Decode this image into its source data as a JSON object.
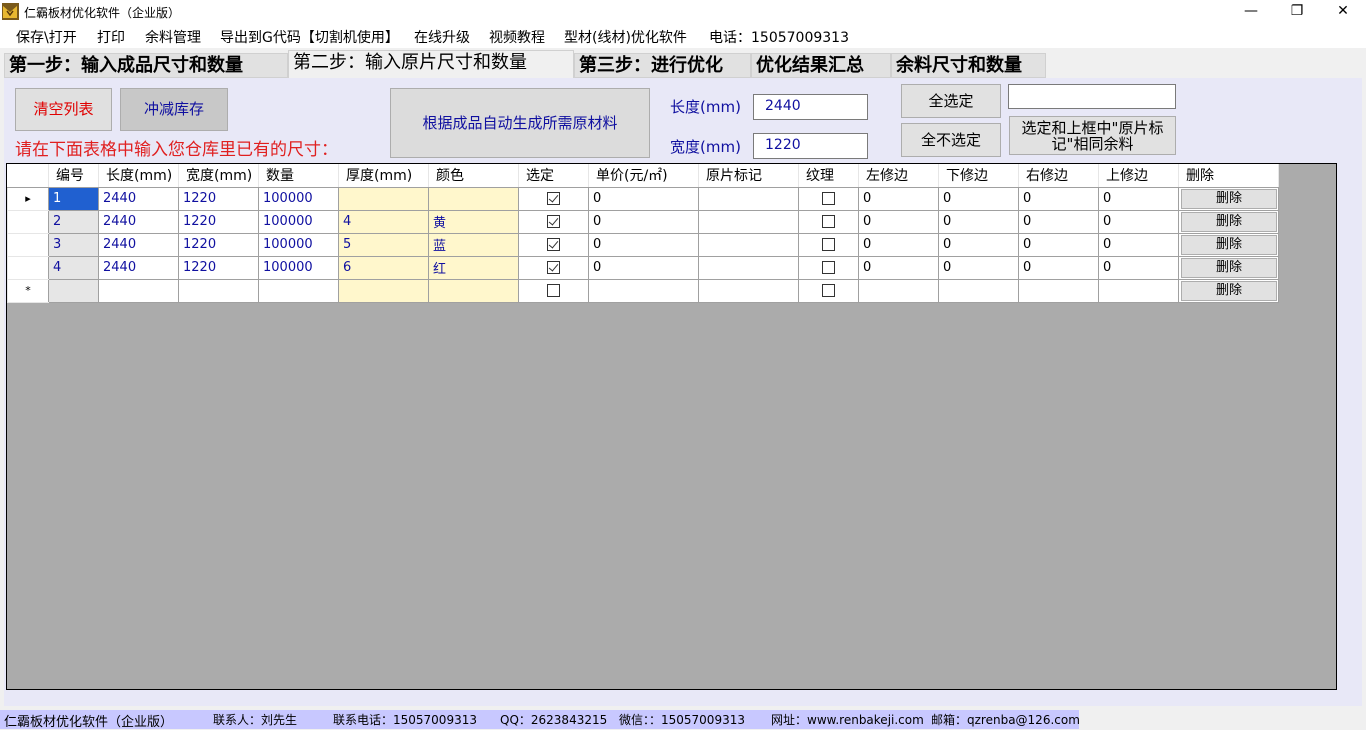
{
  "window": {
    "title": "仁霸板材优化软件（企业版）",
    "minimize": "—",
    "restore": "❐",
    "close": "✕"
  },
  "menu": [
    "保存\\打开",
    "打印",
    "余料管理",
    "导出到G代码【切割机使用】",
    "在线升级",
    "视频教程",
    "型材(线材)优化软件",
    "电话：15057009313"
  ],
  "tabs": [
    "第一步：输入成品尺寸和数量",
    "第二步：输入原片尺寸和数量",
    "第三步：进行优化",
    "优化结果汇总",
    "余料尺寸和数量"
  ],
  "active_tab": 1,
  "buttons": {
    "clear_list": "清空列表",
    "deduct_stock": "冲减库存",
    "auto_generate": "根据成品自动生成所需原材料",
    "select_all": "全选定",
    "select_none": "全不选定",
    "select_same_mark": "选定和上框中\"原片标记\"相同余料"
  },
  "hint": "请在下面表格中输入您仓库里已有的尺寸：",
  "fields": {
    "length_label": "长度(mm)",
    "length_value": "2440",
    "width_label": "宽度(mm)",
    "width_value": "1220",
    "mark_value": ""
  },
  "grid": {
    "columns": [
      "编号",
      "长度(mm)",
      "宽度(mm)",
      "数量",
      "厚度(mm)",
      "颜色",
      "选定",
      "单价(元/㎡)",
      "原片标记",
      "纹理",
      "左修边",
      "下修边",
      "右修边",
      "上修边",
      "删除"
    ],
    "rows": [
      {
        "marker": "▸",
        "id": "1",
        "length": "2440",
        "width": "1220",
        "qty": "100000",
        "thickness": "",
        "color": "",
        "selected": true,
        "price": "0",
        "mark": "",
        "grain": false,
        "left": "0",
        "bottom": "0",
        "right": "0",
        "top": "0",
        "delete": "删除"
      },
      {
        "marker": "",
        "id": "2",
        "length": "2440",
        "width": "1220",
        "qty": "100000",
        "thickness": "4",
        "color": "黄",
        "selected": true,
        "price": "0",
        "mark": "",
        "grain": false,
        "left": "0",
        "bottom": "0",
        "right": "0",
        "top": "0",
        "delete": "删除"
      },
      {
        "marker": "",
        "id": "3",
        "length": "2440",
        "width": "1220",
        "qty": "100000",
        "thickness": "5",
        "color": "蓝",
        "selected": true,
        "price": "0",
        "mark": "",
        "grain": false,
        "left": "0",
        "bottom": "0",
        "right": "0",
        "top": "0",
        "delete": "删除"
      },
      {
        "marker": "",
        "id": "4",
        "length": "2440",
        "width": "1220",
        "qty": "100000",
        "thickness": "6",
        "color": "红",
        "selected": true,
        "price": "0",
        "mark": "",
        "grain": false,
        "left": "0",
        "bottom": "0",
        "right": "0",
        "top": "0",
        "delete": "删除"
      },
      {
        "marker": "*",
        "id": "",
        "length": "",
        "width": "",
        "qty": "",
        "thickness": "",
        "color": "",
        "selected": false,
        "price": "",
        "mark": "",
        "grain": false,
        "left": "",
        "bottom": "",
        "right": "",
        "top": "",
        "delete": "删除"
      }
    ]
  },
  "status": {
    "app": "仁霸板材优化软件（企业版）",
    "contact": "联系人：刘先生",
    "phone": "联系电话：15057009313",
    "qq": "QQ：2623843215",
    "wechat": "微信：：15057009313",
    "site": "网址：www.renbakeji.com",
    "email": "邮箱：qzrenba@126.com"
  },
  "colors": {
    "panel": "#e8e8f7",
    "hint_red": "#e02020",
    "text_blue": "#1010a0",
    "selected_cell": "#2060d0",
    "status_bar": "#c8c8ff",
    "grid_bg": "#ababab"
  }
}
